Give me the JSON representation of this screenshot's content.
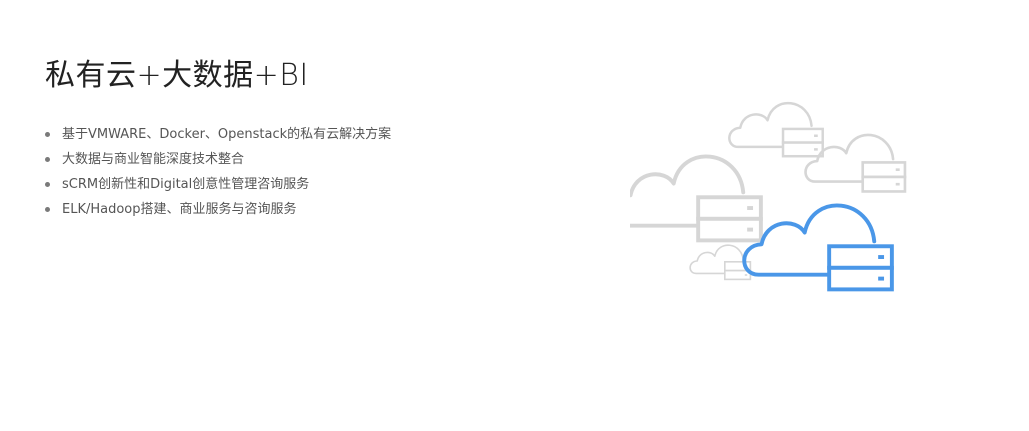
{
  "title": "私有云+大数据+BI",
  "features": [
    "基于VMWARE、Docker、Openstack的私有云解决方案",
    "大数据与商业智能深度技术整合",
    "sCRM创新性和Digital创意性管理咨询服务",
    "ELK/Hadoop搭建、商业服务与咨询服务"
  ],
  "illustration": {
    "icon": "cloud-server-icon",
    "primary_color": "#4a97e8",
    "muted_color": "#d6d6d6"
  }
}
